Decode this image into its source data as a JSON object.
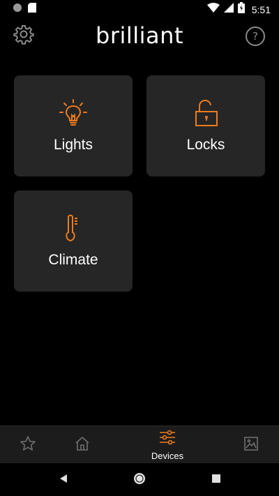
{
  "status_bar": {
    "time": "5:51",
    "icons": [
      "notification-dot-icon",
      "sd-card-icon",
      "wifi-icon",
      "cell-signal-icon",
      "battery-icon"
    ]
  },
  "header": {
    "brand": "brilliant",
    "settings_icon": "gear-icon",
    "help_icon": "help-icon",
    "help_glyph": "?"
  },
  "tiles": [
    {
      "label": "Lights",
      "icon": "lightbulb-icon"
    },
    {
      "label": "Locks",
      "icon": "unlocked-padlock-icon"
    },
    {
      "label": "Climate",
      "icon": "thermometer-icon"
    }
  ],
  "bottom_nav": {
    "items": [
      {
        "label": "",
        "icon": "star-icon"
      },
      {
        "label": "",
        "icon": "home-icon"
      },
      {
        "label": "Devices",
        "icon": "sliders-icon",
        "active": true
      },
      {
        "label": "",
        "icon": "gallery-icon"
      }
    ]
  },
  "colors": {
    "accent": "#f07c1d",
    "tile_background": "#262626",
    "nav_background": "#1c1c1c",
    "inactive_icon": "#6e6e6e"
  }
}
